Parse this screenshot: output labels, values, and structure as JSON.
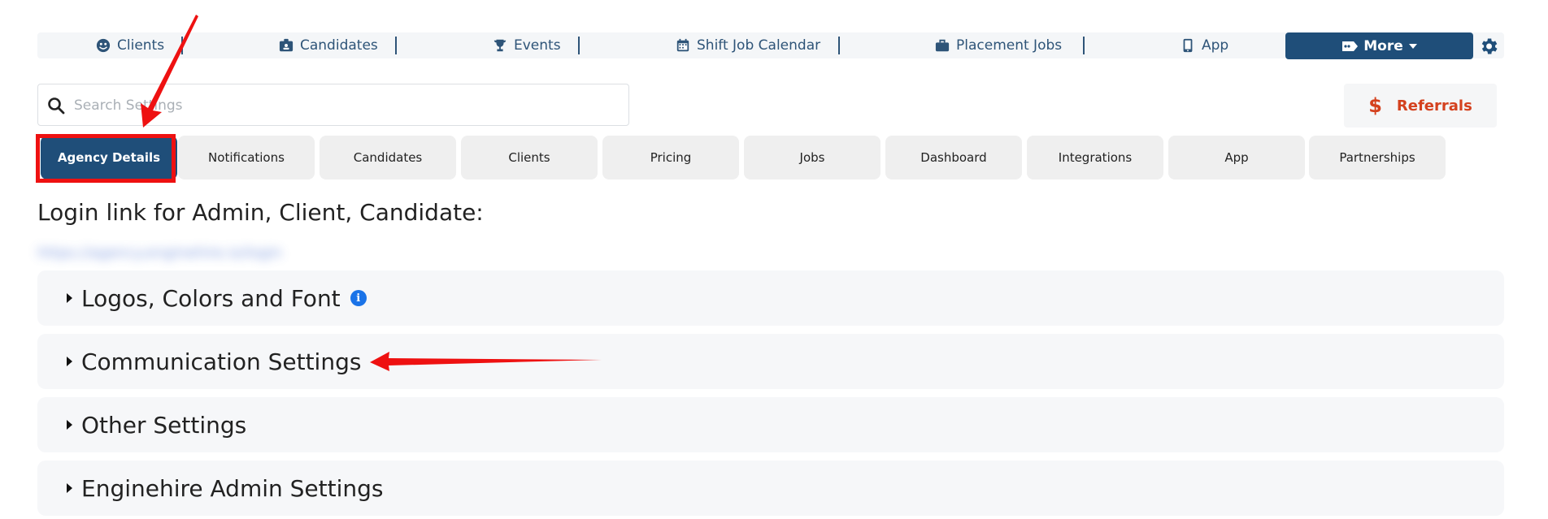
{
  "topnav": {
    "items": [
      {
        "label": "Clients",
        "icon": "face-icon"
      },
      {
        "label": "Candidates",
        "icon": "id-card-icon"
      },
      {
        "label": "Events",
        "icon": "trophy-icon"
      },
      {
        "label": "Shift Job Calendar",
        "icon": "calendar-icon"
      },
      {
        "label": "Placement Jobs",
        "icon": "briefcase-icon"
      },
      {
        "label": "App",
        "icon": "phone-icon"
      }
    ],
    "more_label": "More",
    "accent": "#1f4e79"
  },
  "search": {
    "placeholder": "Search Settings"
  },
  "referrals": {
    "label": "Referrals",
    "color": "#d4411e"
  },
  "tabs": [
    {
      "label": "Agency Details",
      "active": true
    },
    {
      "label": "Notifications"
    },
    {
      "label": "Candidates"
    },
    {
      "label": "Clients"
    },
    {
      "label": "Pricing"
    },
    {
      "label": "Jobs"
    },
    {
      "label": "Dashboard"
    },
    {
      "label": "Integrations"
    },
    {
      "label": "App"
    },
    {
      "label": "Partnerships"
    }
  ],
  "login": {
    "title": "Login link for Admin, Client, Candidate:",
    "link": "https://agency.enginehire.io/login"
  },
  "sections": [
    {
      "label": "Logos, Colors and Font",
      "info": "i"
    },
    {
      "label": "Communication Settings"
    },
    {
      "label": "Other Settings"
    },
    {
      "label": "Enginehire Admin Settings"
    }
  ]
}
